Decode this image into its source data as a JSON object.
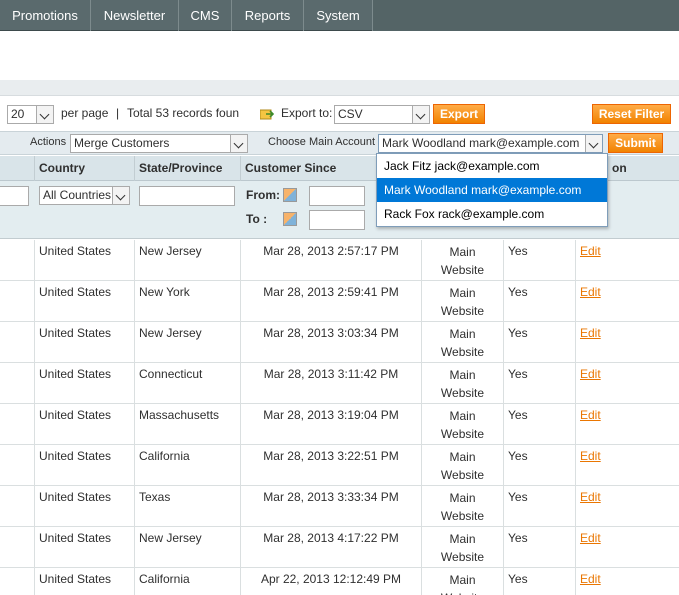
{
  "nav": {
    "items": [
      "Promotions",
      "Newsletter",
      "CMS",
      "Reports",
      "System"
    ]
  },
  "pager": {
    "per_page_value": "20",
    "per_page_label": "per page",
    "separator": "|",
    "total_text": "Total 53 records foun",
    "export_label": "Export to:",
    "export_format": "CSV",
    "export_button": "Export",
    "reset_button": "Reset Filter"
  },
  "massaction": {
    "actions_label": "Actions",
    "action_value": "Merge Customers",
    "main_account_label": "Choose Main Account",
    "main_account_value": "Mark Woodland mark@example.com",
    "submit_button": "Submit"
  },
  "dropdown": {
    "options": [
      "Jack Fitz jack@example.com",
      "Mark Woodland mark@example.com",
      "Rack Fox rack@example.com"
    ],
    "selected_index": 1
  },
  "table": {
    "headers": {
      "country": "Country",
      "state": "State/Province",
      "since": "Customer Since",
      "last": "on"
    },
    "filters": {
      "country_value": "All Countries",
      "from_label": "From:",
      "to_label": "To :"
    },
    "rows": [
      {
        "country": "United States",
        "state": "New Jersey",
        "since": "Mar 28, 2013 2:57:17 PM",
        "website_1": "Main",
        "website_2": "Website",
        "active": "Yes",
        "action": "Edit"
      },
      {
        "country": "United States",
        "state": "New York",
        "since": "Mar 28, 2013 2:59:41 PM",
        "website_1": "Main",
        "website_2": "Website",
        "active": "Yes",
        "action": "Edit"
      },
      {
        "country": "United States",
        "state": "New Jersey",
        "since": "Mar 28, 2013 3:03:34 PM",
        "website_1": "Main",
        "website_2": "Website",
        "active": "Yes",
        "action": "Edit"
      },
      {
        "country": "United States",
        "state": "Connecticut",
        "since": "Mar 28, 2013 3:11:42 PM",
        "website_1": "Main",
        "website_2": "Website",
        "active": "Yes",
        "action": "Edit"
      },
      {
        "country": "United States",
        "state": "Massachusetts",
        "since": "Mar 28, 2013 3:19:04 PM",
        "website_1": "Main",
        "website_2": "Website",
        "active": "Yes",
        "action": "Edit"
      },
      {
        "country": "United States",
        "state": "California",
        "since": "Mar 28, 2013 3:22:51 PM",
        "website_1": "Main",
        "website_2": "Website",
        "active": "Yes",
        "action": "Edit"
      },
      {
        "country": "United States",
        "state": "Texas",
        "since": "Mar 28, 2013 3:33:34 PM",
        "website_1": "Main",
        "website_2": "Website",
        "active": "Yes",
        "action": "Edit"
      },
      {
        "country": "United States",
        "state": "New Jersey",
        "since": "Mar 28, 2013 4:17:22 PM",
        "website_1": "Main",
        "website_2": "Website",
        "active": "Yes",
        "action": "Edit"
      },
      {
        "country": "United States",
        "state": "California",
        "since": "Apr 22, 2013 12:12:49 PM",
        "website_1": "Main",
        "website_2": "Website",
        "active": "Yes",
        "action": "Edit"
      }
    ]
  },
  "colors": {
    "nav_bg": "#5a6a6d",
    "accent_orange": "#f18200",
    "link_orange": "#ea7601",
    "selected_blue": "#0078d7"
  }
}
